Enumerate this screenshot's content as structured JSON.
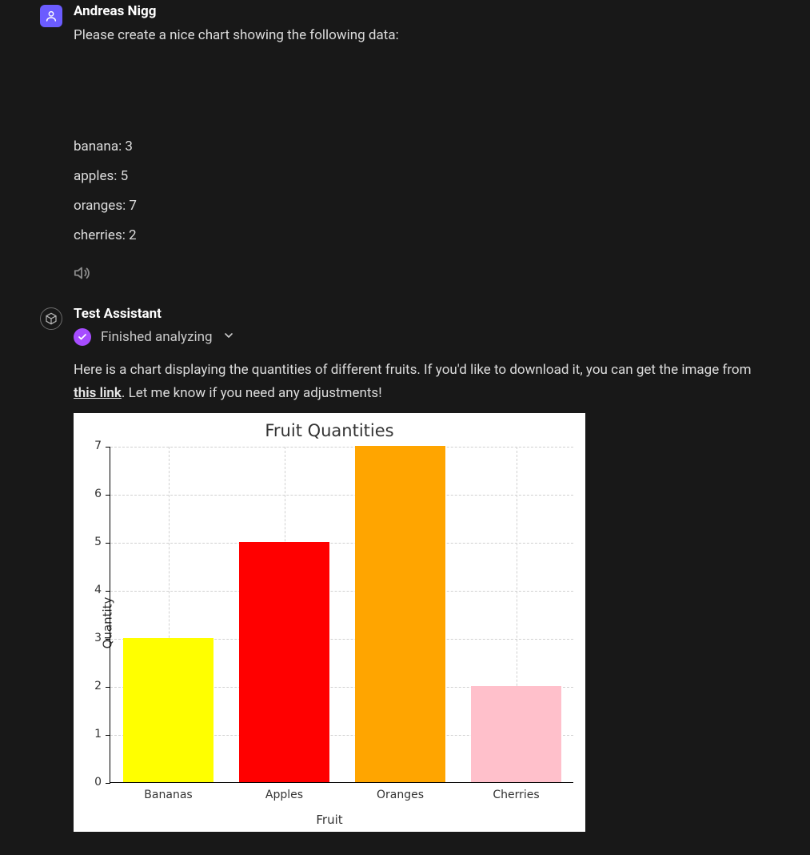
{
  "user": {
    "name": "Andreas Nigg",
    "prompt": "Please create a nice chart showing the following data:",
    "data_lines": [
      "banana: 3",
      "apples: 5",
      "oranges: 7",
      "cherries: 2"
    ]
  },
  "assistant": {
    "name": "Test Assistant",
    "status": "Finished analyzing",
    "reply_before_link": "Here is a chart displaying the quantities of different fruits. If you'd like to download it, you can get the image from ",
    "link_text": "this link",
    "reply_after_link": ". Let me know if you need any adjustments!"
  },
  "chart_data": {
    "type": "bar",
    "title": "Fruit Quantities",
    "xlabel": "Fruit",
    "ylabel": "Quantity",
    "ylim": [
      0,
      7
    ],
    "yticks": [
      0,
      1,
      2,
      3,
      4,
      5,
      6,
      7
    ],
    "categories": [
      "Bananas",
      "Apples",
      "Oranges",
      "Cherries"
    ],
    "values": [
      3,
      5,
      7,
      2
    ],
    "colors": [
      "#ffff00",
      "#ff0000",
      "#ffa500",
      "#ffc0cb"
    ]
  }
}
